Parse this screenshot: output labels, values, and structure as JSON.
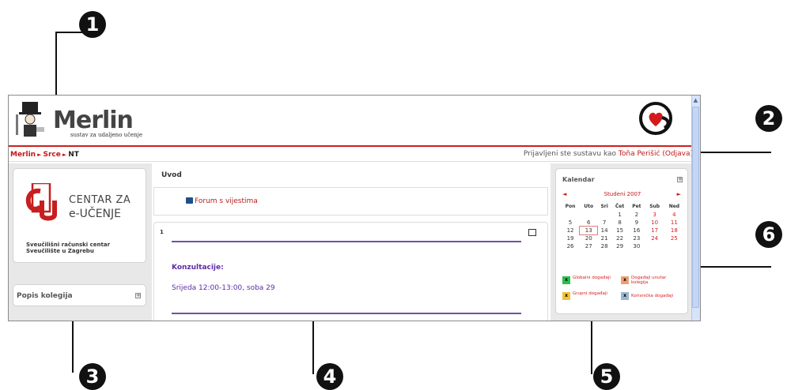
{
  "callouts": [
    "1",
    "2",
    "3",
    "4",
    "5",
    "6"
  ],
  "header": {
    "title": "Merlin",
    "subtitle": "sustav za udaljeno učenje"
  },
  "navbar": {
    "breadcrumb": [
      "Merlin",
      "Srce",
      "NT"
    ],
    "separator": "►",
    "login_prefix": "Prijavljeni ste sustavu kao",
    "user_name": "Toňa Perišić",
    "logout": "(Odjava)"
  },
  "left": {
    "ceu_line1": "CENTAR ZA",
    "ceu_line2": "e-UČENJE",
    "org_line1": "Sveučilišni računski centar",
    "org_line2": "Sveučilište u Zagrebu",
    "course_list_label": "Popis kolegija"
  },
  "center": {
    "section_title": "Uvod",
    "forum_link": "Forum s vijestima",
    "topic_number": "1",
    "consult_title": "Konzultacije:",
    "consult_time": "Srijeda 12:00-13:00, soba 29"
  },
  "calendar": {
    "title": "Kalendar",
    "prev": "◄",
    "next": "►",
    "month": "Studeni 2007",
    "weekdays": [
      "Pon",
      "Uto",
      "Sri",
      "Čet",
      "Pet",
      "Sub",
      "Ned"
    ],
    "weeks": [
      [
        "",
        "",
        "",
        "1",
        "2",
        "3",
        "4"
      ],
      [
        "5",
        "6",
        "7",
        "8",
        "9",
        "10",
        "11"
      ],
      [
        "12",
        "13",
        "14",
        "15",
        "16",
        "17",
        "18"
      ],
      [
        "19",
        "20",
        "21",
        "22",
        "23",
        "24",
        "25"
      ],
      [
        "26",
        "27",
        "28",
        "29",
        "30",
        "",
        ""
      ]
    ],
    "today": "13",
    "legend": {
      "global": "Globalni događaji",
      "course": "Događaji unutar kolegija",
      "group": "Grupni događaji",
      "user": "Korisnička događaji"
    },
    "legend_colors": {
      "global": "#2bbf4a",
      "course": "#f0a070",
      "group": "#f2c23a",
      "user": "#9ab7d0"
    }
  },
  "colors": {
    "accent_red": "#c41616",
    "topic_purple": "#6f4fa8"
  }
}
